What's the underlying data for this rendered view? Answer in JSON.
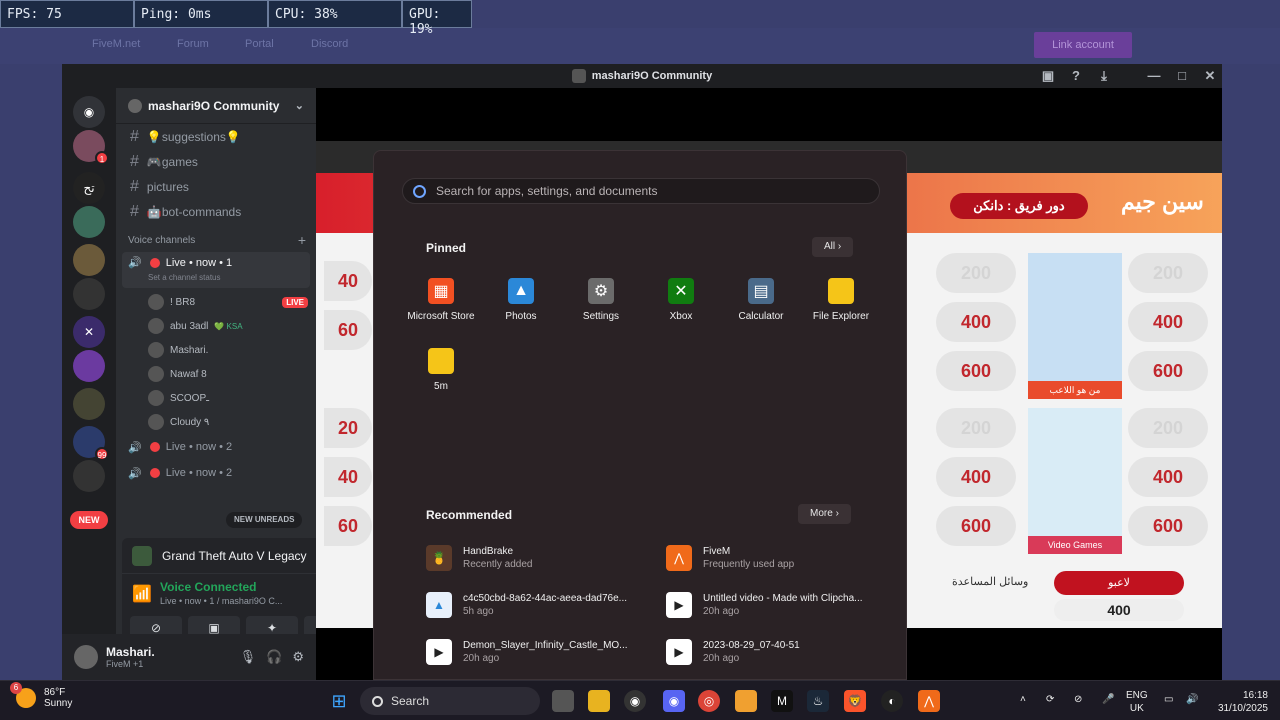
{
  "perf": {
    "fps": "FPS: 75",
    "ping": "Ping: 0ms",
    "cpu": "CPU: 38%",
    "gpu": "GPU: 19%"
  },
  "bg": {
    "links": [
      "FiveM.net",
      "Forum",
      "Portal",
      "Discord"
    ],
    "link_account": "Link account"
  },
  "discord": {
    "window_title": "mashari9O Community",
    "server_name": "mashari9O Community",
    "channels": [
      "💡suggestions💡",
      "🎮games",
      "pictures",
      "🤖bot-commands"
    ],
    "voice_header": "Voice channels",
    "live1": "Live • now • 1",
    "channel_status": "Set a channel status",
    "members": [
      {
        "name": "! BR8",
        "live": "LIVE"
      },
      {
        "name": "abu 3adl",
        "tag": "💚 KSA"
      },
      {
        "name": "Mashari."
      },
      {
        "name": "Nawaf 8"
      },
      {
        "name": "SCOOPـ"
      },
      {
        "name": "Cloudy ٩"
      }
    ],
    "live2": "Live • now • 2",
    "live3": "Live • now • 2",
    "new_unreads": "NEW UNREADS",
    "new_pill": "NEW",
    "game": "Grand Theft Auto V Legacy",
    "voice_connected": "Voice Connected",
    "voice_status": "Live • now • 1 / mashari9O C...",
    "user_name": "Mashari.",
    "user_status": "FiveM +1",
    "guild_badges": [
      "1",
      "99"
    ]
  },
  "shared": {
    "title_ar": "دور فريق : دانكن",
    "logo_ar": "سين جيم",
    "left_vals": [
      "40",
      "60",
      "20",
      "40",
      "60"
    ],
    "rows": [
      {
        "left": "200",
        "right": "200",
        "light": true
      },
      {
        "left": "400",
        "right": "400",
        "light": false
      },
      {
        "left": "600",
        "right": "600",
        "light": false
      },
      {
        "left": "200",
        "right": "200",
        "light": true
      },
      {
        "left": "400",
        "right": "400",
        "light": false
      },
      {
        "left": "600",
        "right": "600",
        "light": false
      }
    ],
    "pic1_cap": "من هو اللاعب",
    "pic2_cap": "Video Games",
    "help_label": "وسائل المساعدة",
    "player_btn": "لاعبو",
    "qty": "400"
  },
  "startmenu": {
    "search_placeholder": "Search for apps, settings, and documents",
    "pinned_label": "Pinned",
    "all_btn": "All",
    "apps": [
      {
        "label": "Microsoft Store",
        "icon": "store-icon",
        "color": "#f25022"
      },
      {
        "label": "Photos",
        "icon": "photos-icon",
        "color": "#2b88d8"
      },
      {
        "label": "Settings",
        "icon": "gear-icon",
        "color": "#6b6b6b"
      },
      {
        "label": "Xbox",
        "icon": "xbox-icon",
        "color": "#107c10"
      },
      {
        "label": "Calculator",
        "icon": "calculator-icon",
        "color": "#4a6a8a"
      },
      {
        "label": "File Explorer",
        "icon": "folder-icon",
        "color": "#f5c518"
      },
      {
        "label": "5m",
        "icon": "folder-icon",
        "color": "#f5c518"
      }
    ],
    "recommended_label": "Recommended",
    "more_btn": "More",
    "recommended": [
      {
        "title": "HandBrake",
        "sub": "Recently added"
      },
      {
        "title": "FiveM",
        "sub": "Frequently used app"
      },
      {
        "title": "c4c50cbd-8a62-44ac-aeea-dad76e...",
        "sub": "5h ago"
      },
      {
        "title": "Untitled video - Made with Clipcha...",
        "sub": "20h ago"
      },
      {
        "title": "Demon_Slayer_Infinity_Castle_MO...",
        "sub": "20h ago"
      },
      {
        "title": "2023-08-29_07-40-51",
        "sub": "20h ago"
      }
    ]
  },
  "taskbar": {
    "temp": "86°F",
    "weather": "Sunny",
    "weather_badge": "6",
    "search": "Search",
    "lang1": "ENG",
    "lang2": "UK",
    "time": "16:18",
    "date": "31/10/2025"
  }
}
